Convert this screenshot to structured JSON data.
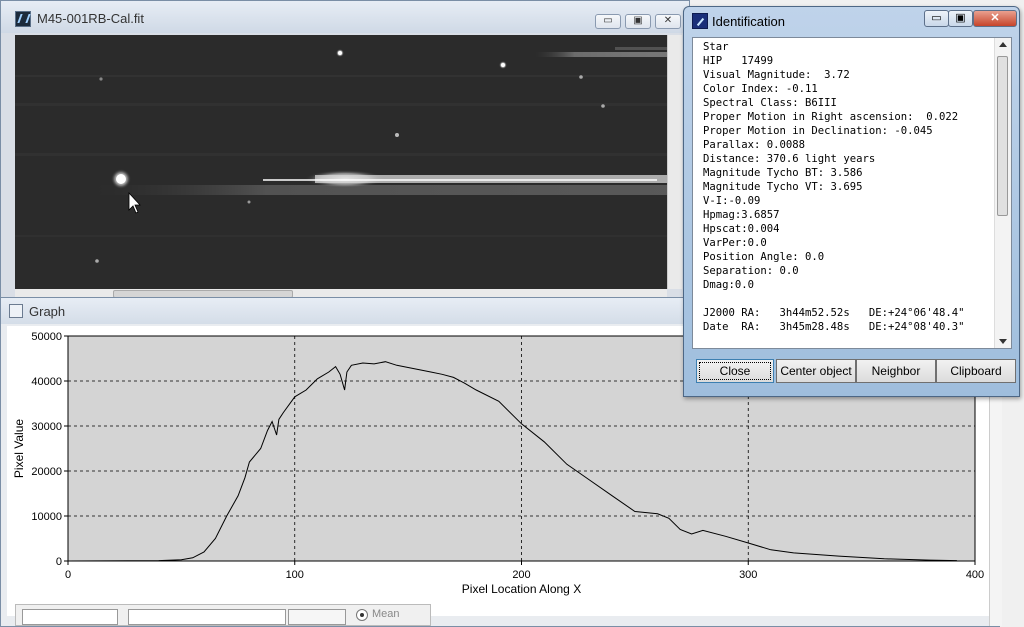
{
  "image_window": {
    "title": "M45-001RB-Cal.fit",
    "buttons": {
      "minimize": "▭",
      "restore": "▣",
      "close": "✕"
    }
  },
  "graph_window": {
    "title": "Graph",
    "bottom_controls": {
      "mean_label": "Mean"
    }
  },
  "identification": {
    "title": "Identification",
    "lines": [
      "Star",
      "HIP   17499",
      "Visual Magnitude:  3.72",
      "Color Index: -0.11",
      "Spectral Class: B6III",
      "Proper Motion in Right ascension:  0.022",
      "Proper Motion in Declination: -0.045",
      "Parallax: 0.0088",
      "Distance: 370.6 light years",
      "Magnitude Tycho BT: 3.586",
      "Magnitude Tycho VT: 3.695",
      "V-I:-0.09",
      "Hpmag:3.6857",
      "Hpscat:0.004",
      "VarPer:0.0",
      "Position Angle: 0.0",
      "Separation: 0.0",
      "Dmag:0.0",
      "",
      "J2000 RA:   3h44m52.52s   DE:+24°06'48.4\"",
      "Date  RA:   3h45m28.48s   DE:+24°08'40.3\""
    ],
    "buttons": {
      "close": "Close",
      "center": "Center object",
      "neighbor": "Neighbor",
      "clipboard": "Clipboard"
    }
  },
  "chart_data": {
    "type": "line",
    "title": "",
    "xlabel": "Pixel Location Along X",
    "ylabel": "Pixel Value",
    "xlim": [
      0,
      400
    ],
    "ylim": [
      0,
      50000
    ],
    "xticks": [
      0,
      100,
      200,
      300,
      400
    ],
    "yticks": [
      0,
      10000,
      20000,
      30000,
      40000,
      50000
    ],
    "grid": true,
    "series": [
      {
        "x": [
          0,
          40,
          50,
          55,
          60,
          65,
          70,
          75,
          78,
          80,
          85,
          88,
          90,
          92,
          93,
          95,
          100,
          105,
          110,
          115,
          118,
          120,
          122,
          123,
          125,
          130,
          135,
          140,
          145,
          150,
          155,
          160,
          165,
          170,
          175,
          180,
          190,
          200,
          210,
          220,
          230,
          240,
          250,
          260,
          265,
          270,
          275,
          280,
          290,
          300,
          310,
          320,
          340,
          360,
          380,
          392
        ],
        "y": [
          0,
          100,
          300,
          700,
          2000,
          5000,
          10000,
          14500,
          18500,
          22000,
          25000,
          29000,
          31000,
          28000,
          31500,
          33000,
          36500,
          38000,
          40500,
          42000,
          43200,
          41500,
          38000,
          42000,
          43500,
          44000,
          43800,
          44300,
          43500,
          43000,
          42500,
          42000,
          41500,
          40800,
          39500,
          38000,
          35500,
          30500,
          26500,
          21500,
          18000,
          14500,
          11000,
          10500,
          9500,
          7000,
          6000,
          6800,
          5500,
          4000,
          2500,
          1800,
          1100,
          500,
          200,
          100
        ]
      }
    ]
  }
}
